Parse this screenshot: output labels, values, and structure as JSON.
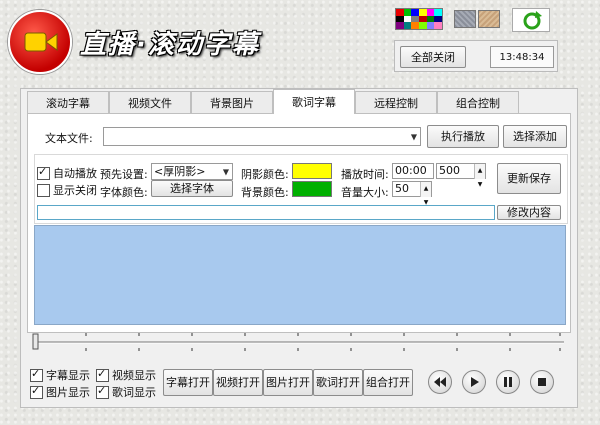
{
  "header": {
    "title": "直播·滚动字幕",
    "close_all_label": "全部关闭",
    "clock": "13:48:34",
    "palette_colors": [
      "#e60000",
      "#00c000",
      "#0000ff",
      "#ffff00",
      "#ff00ff",
      "#00ffff",
      "#000000",
      "#ffffff",
      "#808080",
      "#c00000",
      "#008000",
      "#000080",
      "#800080",
      "#008080",
      "#ff8000",
      "#80ff00",
      "#8080ff",
      "#ff80c0"
    ]
  },
  "tabs": [
    {
      "label": "滚动字幕"
    },
    {
      "label": "视频文件"
    },
    {
      "label": "背景图片"
    },
    {
      "label": "歌词字幕",
      "active": true
    },
    {
      "label": "远程控制"
    },
    {
      "label": "组合控制"
    }
  ],
  "file_row": {
    "label": "文本文件:",
    "value": "",
    "play_label": "执行播放",
    "add_label": "选择添加"
  },
  "settings": {
    "autoplay_label": "自动播放",
    "autoplay_checked": true,
    "show_close_label": "显示关闭",
    "show_close_checked": false,
    "preset_label": "预先设置:",
    "preset_value": "<厚阴影>",
    "font_color_label": "字体颜色:",
    "choose_font_label": "选择字体",
    "shadow_color_label": "阴影颜色:",
    "shadow_color": "#ffff00",
    "bg_color_label": "背景颜色:",
    "bg_color": "#00b000",
    "play_time_label": "播放时间:",
    "play_time": "00:00",
    "duration": "500",
    "volume_label": "音量大小:",
    "volume": "50",
    "save_label": "更新保存"
  },
  "edit": {
    "line_value": "",
    "modify_label": "修改内容"
  },
  "bottom": {
    "checks": [
      {
        "label": "字幕显示",
        "checked": true
      },
      {
        "label": "视频显示",
        "checked": true
      },
      {
        "label": "图片显示",
        "checked": true
      },
      {
        "label": "歌词显示",
        "checked": true
      }
    ],
    "open_buttons": [
      "字幕打开",
      "视频打开",
      "图片打开",
      "歌词打开",
      "组合打开"
    ]
  },
  "icons": {
    "logo": "video-camera-icon",
    "refresh": "refresh-icon",
    "rewind": "rewind-icon",
    "play": "play-icon",
    "pause": "pause-icon",
    "stop": "stop-icon"
  }
}
